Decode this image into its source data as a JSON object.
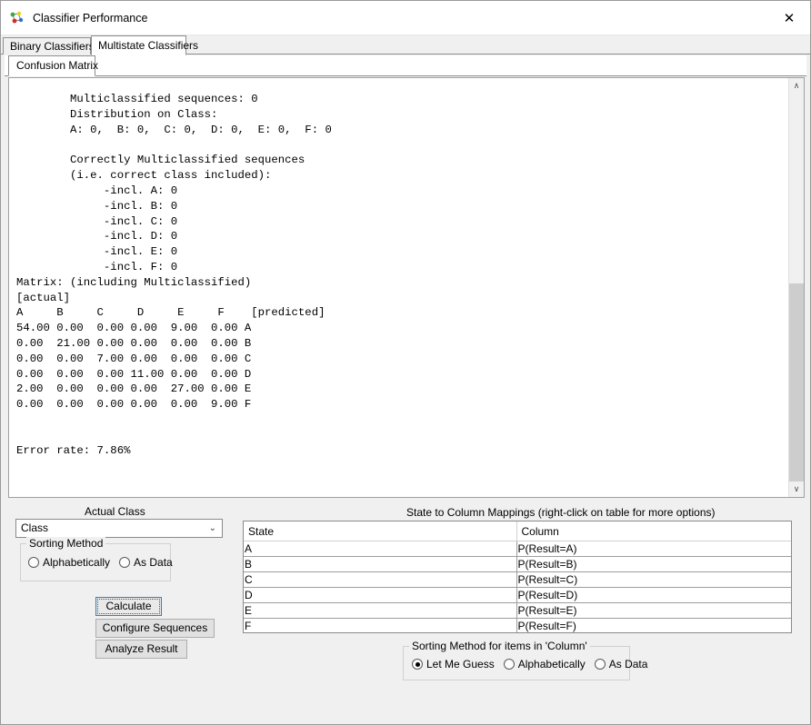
{
  "window": {
    "title": "Classifier Performance",
    "icon": "classifier-network-icon",
    "close_label": "✕"
  },
  "tabs": {
    "main": [
      {
        "label": "Binary Classifiers",
        "active": false
      },
      {
        "label": "Multistate Classifiers",
        "active": true
      }
    ],
    "sub": [
      {
        "label": "Confusion Matrix",
        "active": true
      }
    ]
  },
  "output": {
    "text": "        Multiclassified sequences: 0\n        Distribution on Class:\n        A: 0,  B: 0,  C: 0,  D: 0,  E: 0,  F: 0\n\n        Correctly Multiclassified sequences\n        (i.e. correct class included):\n             -incl. A: 0\n             -incl. B: 0\n             -incl. C: 0\n             -incl. D: 0\n             -incl. E: 0\n             -incl. F: 0\nMatrix: (including Multiclassified)\n[actual]\nA     B     C     D     E     F    [predicted]\n54.00 0.00  0.00 0.00  9.00  0.00 A\n0.00  21.00 0.00 0.00  0.00  0.00 B\n0.00  0.00  7.00 0.00  0.00  0.00 C\n0.00  0.00  0.00 11.00 0.00  0.00 D\n2.00  0.00  0.00 0.00  27.00 0.00 E\n0.00  0.00  0.00 0.00  0.00  9.00 F\n\n\nError rate: 7.86%",
    "error_rate": "7.86%",
    "scrollbar": {
      "up_arrow": "∧",
      "down_arrow": "∨"
    }
  },
  "matrix_data": {
    "title": "Matrix: (including Multiclassified)",
    "actual_label": "[actual]",
    "predicted_label": "[predicted]",
    "classes": [
      "A",
      "B",
      "C",
      "D",
      "E",
      "F"
    ],
    "rows": [
      {
        "predicted": "A",
        "values": [
          "54.00",
          "0.00",
          "0.00",
          "0.00",
          "9.00",
          "0.00"
        ]
      },
      {
        "predicted": "B",
        "values": [
          "0.00",
          "21.00",
          "0.00",
          "0.00",
          "0.00",
          "0.00"
        ]
      },
      {
        "predicted": "C",
        "values": [
          "0.00",
          "0.00",
          "7.00",
          "0.00",
          "0.00",
          "0.00"
        ]
      },
      {
        "predicted": "D",
        "values": [
          "0.00",
          "0.00",
          "0.00",
          "11.00",
          "0.00",
          "0.00"
        ]
      },
      {
        "predicted": "E",
        "values": [
          "2.00",
          "0.00",
          "0.00",
          "0.00",
          "27.00",
          "0.00"
        ]
      },
      {
        "predicted": "F",
        "values": [
          "0.00",
          "0.00",
          "0.00",
          "0.00",
          "0.00",
          "9.00"
        ]
      }
    ],
    "multiclassified_sequences": "0",
    "distribution_on_class": {
      "A": "0",
      "B": "0",
      "C": "0",
      "D": "0",
      "E": "0",
      "F": "0"
    },
    "correct_multiclassified": {
      "A": "0",
      "B": "0",
      "C": "0",
      "D": "0",
      "E": "0",
      "F": "0"
    }
  },
  "actual_class": {
    "title": "Actual Class",
    "combo_value": "Class",
    "combo_chevron": "⌄",
    "sorting": {
      "title": "Sorting Method",
      "options": [
        {
          "label": "Alphabetically",
          "checked": false
        },
        {
          "label": "As Data",
          "checked": false
        }
      ]
    }
  },
  "buttons": {
    "calculate": "Calculate",
    "configure_sequences": "Configure Sequences",
    "analyze_result": "Analyze Result"
  },
  "mappings": {
    "title": "State to Column Mappings (right-click on table for more options)",
    "headers": [
      "State",
      "Column"
    ],
    "rows": [
      {
        "state": "A",
        "column": "P(Result=A)"
      },
      {
        "state": "B",
        "column": "P(Result=B)"
      },
      {
        "state": "C",
        "column": "P(Result=C)"
      },
      {
        "state": "D",
        "column": "P(Result=D)"
      },
      {
        "state": "E",
        "column": "P(Result=E)"
      },
      {
        "state": "F",
        "column": "P(Result=F)"
      }
    ]
  },
  "column_sorting": {
    "title": "Sorting Method for items in 'Column'",
    "options": [
      {
        "label": "Let Me Guess",
        "checked": true
      },
      {
        "label": "Alphabetically",
        "checked": false
      },
      {
        "label": "As Data",
        "checked": false
      }
    ]
  },
  "colors": {
    "window_bg": "#f0f0f0",
    "panel_bg": "#ffffff",
    "border": "#8a8a8a",
    "focus_blue": "#3c7fb1",
    "scroll_thumb": "#cdcdcd"
  }
}
